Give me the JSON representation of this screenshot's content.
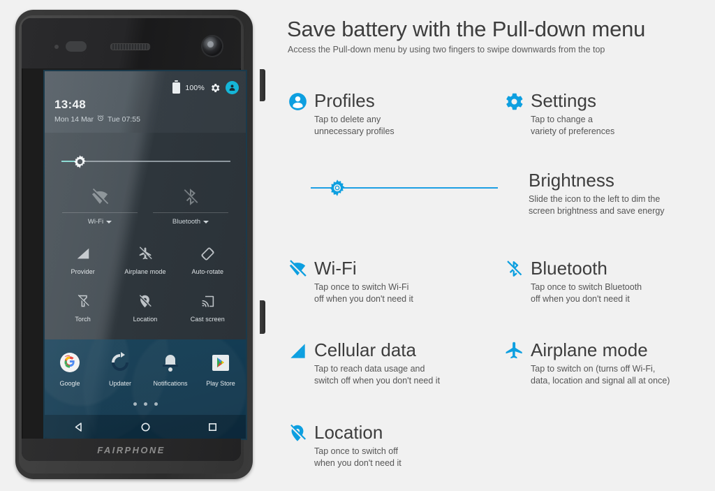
{
  "page": {
    "title": "Save battery with the Pull-down menu",
    "subtitle": "Access the Pull-down menu by using two fingers to swipe downwards from the top",
    "background_color": "#f1f1f1",
    "accent_color": "#0d9fe0",
    "heading_color": "#3d3d3d"
  },
  "features": [
    {
      "key": "profiles",
      "icon": "profile-person-icon",
      "name": "Profiles",
      "desc_line1": "Tap to delete any",
      "desc_line2": "unnecessary profiles"
    },
    {
      "key": "settings",
      "icon": "gear-icon",
      "name": "Settings",
      "desc_line1": "Tap to change a",
      "desc_line2": "variety of preferences"
    },
    {
      "key": "brightness",
      "icon": "brightness-sun-icon",
      "name": "Brightness",
      "desc_line1": "Slide the icon to the left to dim the",
      "desc_line2": "screen brightness and save energy",
      "slider_position_percent": 9
    },
    {
      "key": "wifi",
      "icon": "wifi-off-icon",
      "name": "Wi-Fi",
      "desc_line1": "Tap once to switch Wi-Fi",
      "desc_line2": "off when you don't need it"
    },
    {
      "key": "bluetooth",
      "icon": "bluetooth-off-icon",
      "name": "Bluetooth",
      "desc_line1": "Tap once to switch Bluetooth",
      "desc_line2": "off when you don't need it"
    },
    {
      "key": "cellular",
      "icon": "cellular-signal-icon",
      "name": "Cellular data",
      "desc_line1": "Tap to reach data usage and",
      "desc_line2": "switch off when you don't need it"
    },
    {
      "key": "airplane",
      "icon": "airplane-icon",
      "name": "Airplane mode",
      "desc_line1": "Tap to switch on (turns off Wi-Fi,",
      "desc_line2": "data, location and signal all at once)"
    },
    {
      "key": "location",
      "icon": "location-pin-off-icon",
      "name": "Location",
      "desc_line1": "Tap once to switch off",
      "desc_line2": "when you don't need it"
    }
  ],
  "phone": {
    "brand": "FAIRPHONE",
    "statusbar": {
      "battery_percent": "100%",
      "battery_icon": "battery-full-icon",
      "settings_icon": "gear-icon",
      "avatar_icon": "user-avatar-icon"
    },
    "clock": {
      "time": "13:48",
      "date": "Mon 14 Mar",
      "alarm_icon": "alarm-clock-icon",
      "alarm_time": "Tue 07:55"
    },
    "brightness_slider": {
      "name": "brightness-slider",
      "position_percent": 11
    },
    "connectivity": [
      {
        "key": "wifi",
        "label": "Wi-Fi",
        "icon": "wifi-off-icon",
        "has_caret": true
      },
      {
        "key": "bluetooth",
        "label": "Bluetooth",
        "icon": "bluetooth-off-icon",
        "has_caret": true
      }
    ],
    "tiles": [
      {
        "key": "provider",
        "label": "Provider",
        "icon": "cellular-signal-icon"
      },
      {
        "key": "airplane",
        "label": "Airplane mode",
        "icon": "airplane-off-icon"
      },
      {
        "key": "autorotate",
        "label": "Auto-rotate",
        "icon": "auto-rotate-icon"
      },
      {
        "key": "torch",
        "label": "Torch",
        "icon": "torch-off-icon"
      },
      {
        "key": "location",
        "label": "Location",
        "icon": "location-pin-off-icon"
      },
      {
        "key": "cast",
        "label": "Cast screen",
        "icon": "cast-screen-icon"
      }
    ],
    "dock": [
      {
        "key": "google",
        "label": "Google",
        "icon": "google-icon"
      },
      {
        "key": "updater",
        "label": "Updater",
        "icon": "updater-icon"
      },
      {
        "key": "notifications",
        "label": "Notifications",
        "icon": "bell-icon"
      },
      {
        "key": "playstore",
        "label": "Play Store",
        "icon": "play-store-icon"
      }
    ],
    "page_dots": 3,
    "navbar": [
      {
        "key": "back",
        "icon": "back-triangle-icon"
      },
      {
        "key": "home",
        "icon": "home-circle-icon"
      },
      {
        "key": "recents",
        "icon": "recents-square-icon"
      }
    ]
  }
}
